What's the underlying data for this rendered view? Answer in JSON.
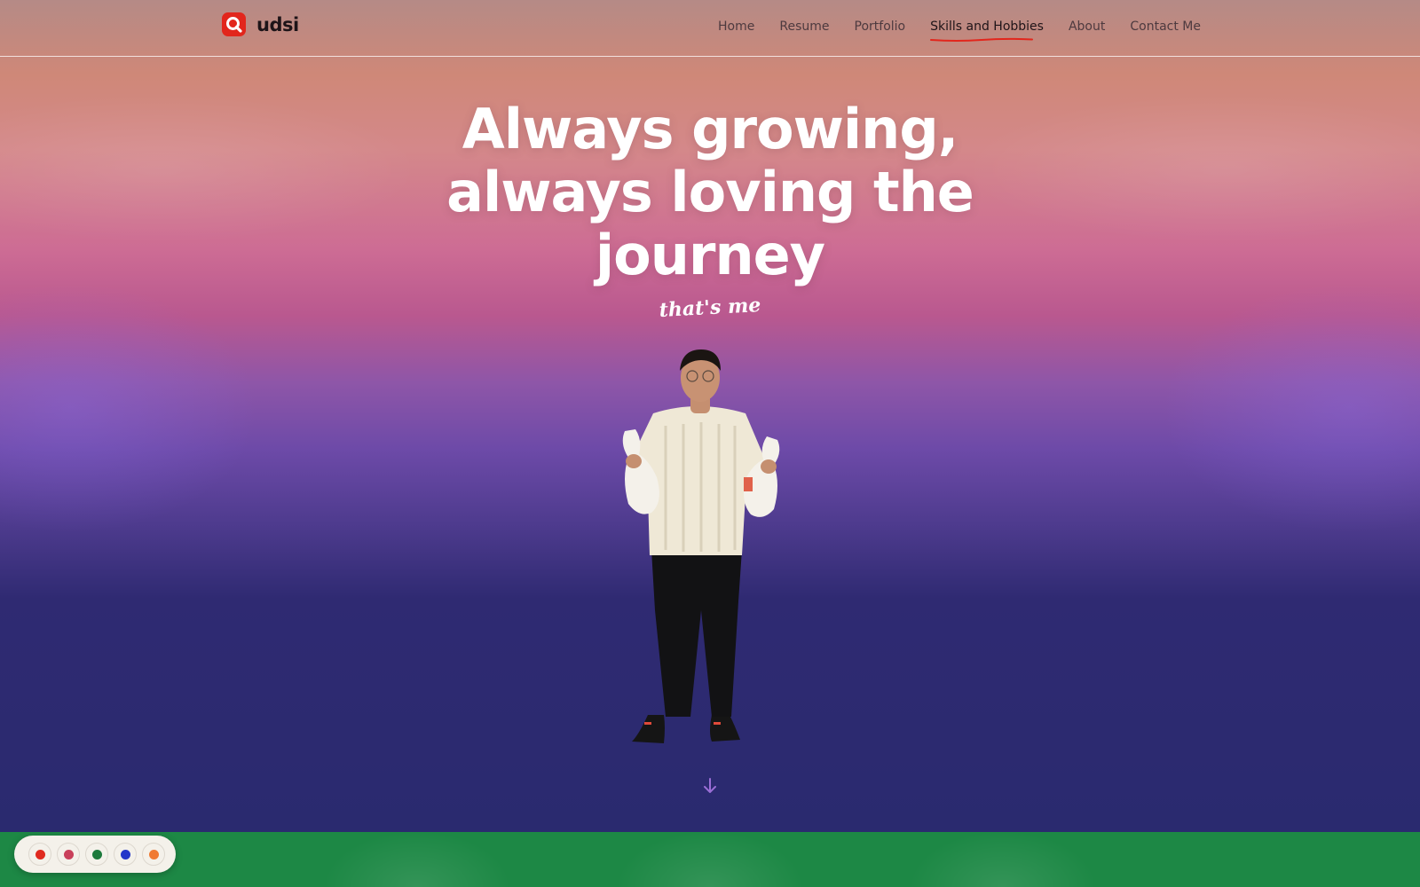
{
  "header": {
    "brand": "udsi",
    "nav": [
      {
        "label": "Home",
        "active": false
      },
      {
        "label": "Resume",
        "active": false
      },
      {
        "label": "Portfolio",
        "active": false
      },
      {
        "label": "Skills and Hobbies",
        "active": true
      },
      {
        "label": "About",
        "active": false
      },
      {
        "label": "Contact Me",
        "active": false
      }
    ]
  },
  "hero": {
    "headline_line1": "Always growing,",
    "headline_line2": "always loving the",
    "headline_line3": "journey",
    "tagline": "that's me",
    "image": "person-holding-bowling-pins",
    "scroll_icon": "arrow-down-icon"
  },
  "theme_switcher": {
    "swatches": [
      {
        "name": "red",
        "color": "#e02b1f"
      },
      {
        "name": "rose",
        "color": "#c9405a"
      },
      {
        "name": "green",
        "color": "#1d7a3c"
      },
      {
        "name": "blue",
        "color": "#2537c9"
      },
      {
        "name": "orange",
        "color": "#f07a32"
      }
    ]
  },
  "colors": {
    "accent": "#e2261c",
    "bottom_section": "#1d8845"
  }
}
